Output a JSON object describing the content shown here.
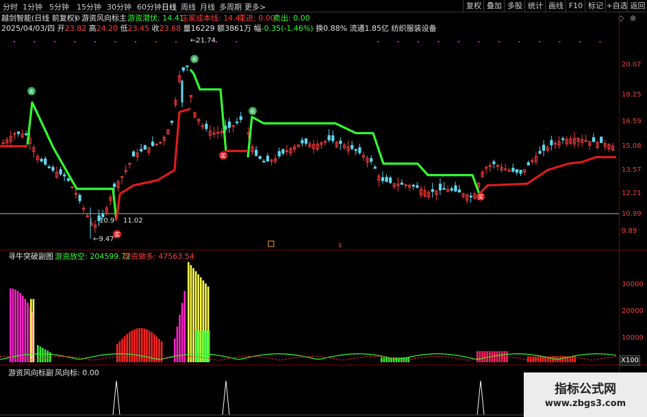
{
  "toolbar": {
    "periods": [
      "分时",
      "1分钟",
      "5分钟",
      "15分钟",
      "30分钟",
      "60分钟",
      "日线",
      "周线",
      "月线",
      "多周期",
      "更多"
    ],
    "active_period": "日线",
    "more_arrow": ">",
    "right_buttons": [
      "复权",
      "叠加",
      "多股",
      "统计",
      "画线",
      "F10",
      "标记",
      "+自选",
      "返回"
    ]
  },
  "chart_header": {
    "stock_title": "越剑智能(日线 前复权)",
    "indicator_name": "游资风向标主",
    "items": [
      {
        "label": "游资潜伏:",
        "value": "14.41",
        "color": "green"
      },
      {
        "label": "庄家成本线:",
        "value": "14.41",
        "color": "red"
      },
      {
        "label": "买进:",
        "value": "0.00",
        "color": "red"
      },
      {
        "label": "卖出:",
        "value": "0.00",
        "color": "green"
      }
    ],
    "window_icons": [
      "◇",
      "⊗"
    ]
  },
  "quote_line": {
    "date": "2025/04/03/四",
    "open_label": "开",
    "open": "23.82",
    "high_label": "高",
    "high": "24.20",
    "low_label": "低",
    "low": "23.45",
    "close_label": "收",
    "close": "23.68",
    "volume_label": "量",
    "volume": "16229",
    "amount_label": "额",
    "amount": "3861万",
    "change_label": "幅",
    "change": "-0.35(-1.46%)",
    "turnover_label": "换",
    "turnover": "0.88%",
    "float_label": "流通",
    "float_cap": "1.85亿",
    "industry": "纺织服装设备"
  },
  "price_axis": [
    "20.07",
    "18.25",
    "16.59",
    "15.08",
    "13.57",
    "12.21",
    "10.99",
    "9.89"
  ],
  "price_annotations": {
    "high": "21.74",
    "low": "9.47",
    "level_left": "10.9",
    "level_right": "11.02"
  },
  "marker_labels": {
    "buy": "买",
    "sell": "卖"
  },
  "sub1": {
    "name": "寻牛突破副图",
    "items": [
      {
        "label": "游资放空:",
        "value": "204599.72",
        "color": "green"
      },
      {
        "label": "游资做多:",
        "value": "47563.54",
        "color": "red"
      }
    ],
    "axis": [
      "30000",
      "20000",
      "10000"
    ],
    "unit": "X100"
  },
  "sub2": {
    "name": "游资风向标副",
    "label": "风向标:",
    "value": "0.00"
  },
  "watermark": {
    "line1": "指标公式网",
    "line2": "www.zbgs3.com"
  },
  "colors": {
    "up": "#ff3b3b",
    "down": "#5fd8f0",
    "support": "#33ff33",
    "cost": "#dd1b1b",
    "bg": "#000000"
  },
  "chart_data": {
    "type": "candlestick",
    "title": "越剑智能(日线 前复权)",
    "price_ticks": [
      20.07,
      18.25,
      16.59,
      15.08,
      13.57,
      12.21,
      10.99,
      9.89
    ],
    "period_high": 21.74,
    "period_low": 9.47,
    "last_close": 23.68,
    "cost_line_last": 14.41,
    "volume_axis_ticks": [
      30000,
      20000,
      10000
    ]
  }
}
